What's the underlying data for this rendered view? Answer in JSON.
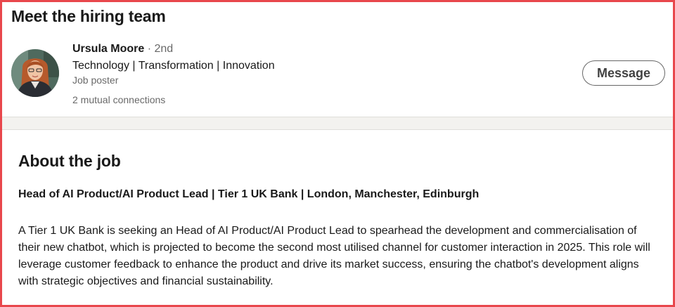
{
  "hiring_team": {
    "title": "Meet the hiring team",
    "poster": {
      "name": "Ursula Moore",
      "degree": " · 2nd",
      "headline": "Technology | Transformation | Innovation",
      "role": "Job poster",
      "mutual_connections": "2 mutual connections"
    },
    "message_button": "Message"
  },
  "about_job": {
    "title": "About the job",
    "headline": "Head of AI Product/AI Product Lead | Tier 1 UK Bank | London, Manchester, Edinburgh",
    "description": "A Tier 1 UK Bank is seeking an Head of AI Product/AI Product Lead to spearhead the development and commercialisation of their new chatbot, which is projected to become the second most utilised channel for customer interaction in 2025. This role will leverage customer feedback to enhance the product and drive its market success, ensuring the chatbot's development aligns with strategic objectives and financial sustainability."
  },
  "colors": {
    "frame_border": "#e8474c",
    "page_background": "#f3f2ef",
    "card_background": "#ffffff"
  },
  "icons": {
    "avatar": "profile-photo"
  }
}
